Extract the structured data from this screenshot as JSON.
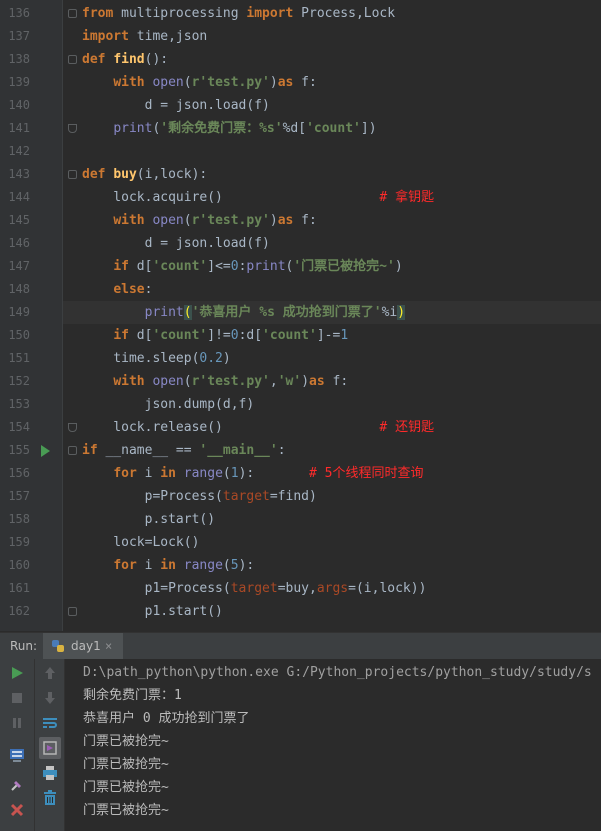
{
  "editor": {
    "line_numbers": [
      "136",
      "137",
      "138",
      "139",
      "140",
      "141",
      "142",
      "143",
      "144",
      "145",
      "146",
      "147",
      "148",
      "149",
      "150",
      "151",
      "152",
      "153",
      "154",
      "155",
      "156",
      "157",
      "158",
      "159",
      "160",
      "161",
      "162"
    ],
    "lines": [
      {
        "tokens": [
          [
            "kw",
            "from"
          ],
          [
            "t",
            " multiprocessing "
          ],
          [
            "kw",
            "import"
          ],
          [
            "t",
            " Process,Lock"
          ]
        ]
      },
      {
        "tokens": [
          [
            "kw",
            "import"
          ],
          [
            "t",
            " time,json"
          ]
        ]
      },
      {
        "tokens": [
          [
            "kw",
            "def"
          ],
          [
            "t",
            " "
          ],
          [
            "fn",
            "find"
          ],
          [
            "t",
            "():"
          ]
        ]
      },
      {
        "tokens": [
          [
            "t",
            "    "
          ],
          [
            "kw",
            "with"
          ],
          [
            "t",
            " "
          ],
          [
            "bi",
            "open"
          ],
          [
            "t",
            "("
          ],
          [
            "str",
            "r'test.py'"
          ],
          [
            "t",
            ")"
          ],
          [
            "kw",
            "as"
          ],
          [
            "t",
            " f:"
          ]
        ]
      },
      {
        "tokens": [
          [
            "t",
            "        d = json.load(f)"
          ]
        ]
      },
      {
        "tokens": [
          [
            "t",
            "    "
          ],
          [
            "bi",
            "print"
          ],
          [
            "t",
            "("
          ],
          [
            "str",
            "'剩余免费门票：%s'"
          ],
          [
            "t",
            "%d["
          ],
          [
            "str",
            "'count'"
          ],
          [
            "t",
            "])"
          ]
        ]
      },
      {
        "tokens": []
      },
      {
        "tokens": [
          [
            "kw",
            "def"
          ],
          [
            "t",
            " "
          ],
          [
            "fn",
            "buy"
          ],
          [
            "t",
            "(i,lock):"
          ]
        ]
      },
      {
        "tokens": [
          [
            "t",
            "    lock.acquire()                    "
          ],
          [
            "cmt",
            "# 拿钥匙"
          ]
        ]
      },
      {
        "tokens": [
          [
            "t",
            "    "
          ],
          [
            "kw",
            "with"
          ],
          [
            "t",
            " "
          ],
          [
            "bi",
            "open"
          ],
          [
            "t",
            "("
          ],
          [
            "str",
            "r'test.py'"
          ],
          [
            "t",
            ")"
          ],
          [
            "kw",
            "as"
          ],
          [
            "t",
            " f:"
          ]
        ]
      },
      {
        "tokens": [
          [
            "t",
            "        d = json.load(f)"
          ]
        ]
      },
      {
        "tokens": [
          [
            "t",
            "    "
          ],
          [
            "kw",
            "if"
          ],
          [
            "t",
            " d["
          ],
          [
            "str",
            "'count'"
          ],
          [
            "t",
            "]<="
          ],
          [
            "num",
            "0"
          ],
          [
            "t",
            ":"
          ],
          [
            "bi",
            "print"
          ],
          [
            "t",
            "("
          ],
          [
            "str",
            "'门票已被抢完~'"
          ],
          [
            "t",
            ")"
          ]
        ]
      },
      {
        "tokens": [
          [
            "t",
            "    "
          ],
          [
            "kw",
            "else"
          ],
          [
            "t",
            ":"
          ]
        ]
      },
      {
        "tokens": [
          [
            "t",
            "        "
          ],
          [
            "bi",
            "print"
          ],
          [
            "hl",
            "("
          ],
          [
            "str",
            "'恭喜用户 %s 成功抢到门票了'"
          ],
          [
            "t",
            "%i"
          ],
          [
            "hl",
            ")"
          ]
        ]
      },
      {
        "tokens": [
          [
            "t",
            "    "
          ],
          [
            "kw",
            "if"
          ],
          [
            "t",
            " d["
          ],
          [
            "str",
            "'count'"
          ],
          [
            "t",
            "]!="
          ],
          [
            "num",
            "0"
          ],
          [
            "t",
            ":d["
          ],
          [
            "str",
            "'count'"
          ],
          [
            "t",
            "]-="
          ],
          [
            "num",
            "1"
          ]
        ]
      },
      {
        "tokens": [
          [
            "t",
            "    time.sleep("
          ],
          [
            "num",
            "0.2"
          ],
          [
            "t",
            ")"
          ]
        ]
      },
      {
        "tokens": [
          [
            "t",
            "    "
          ],
          [
            "kw",
            "with"
          ],
          [
            "t",
            " "
          ],
          [
            "bi",
            "open"
          ],
          [
            "t",
            "("
          ],
          [
            "str",
            "r'test.py'"
          ],
          [
            "t",
            ","
          ],
          [
            "str",
            "'w'"
          ],
          [
            "t",
            ")"
          ],
          [
            "kw",
            "as"
          ],
          [
            "t",
            " f:"
          ]
        ]
      },
      {
        "tokens": [
          [
            "t",
            "        json.dump(d,f)"
          ]
        ]
      },
      {
        "tokens": [
          [
            "t",
            "    lock.release()                    "
          ],
          [
            "cmt",
            "# 还钥匙"
          ]
        ]
      },
      {
        "tokens": [
          [
            "kw",
            "if"
          ],
          [
            "t",
            " __name__ == "
          ],
          [
            "str",
            "'__main__'"
          ],
          [
            "t",
            ":"
          ]
        ]
      },
      {
        "tokens": [
          [
            "t",
            "    "
          ],
          [
            "kw",
            "for"
          ],
          [
            "t",
            " i "
          ],
          [
            "kw",
            "in"
          ],
          [
            "t",
            " "
          ],
          [
            "bi",
            "range"
          ],
          [
            "t",
            "("
          ],
          [
            "num",
            "1"
          ],
          [
            "t",
            "):       "
          ],
          [
            "cmt",
            "# 5个线程同时查询"
          ]
        ]
      },
      {
        "tokens": [
          [
            "t",
            "        p=Process("
          ],
          [
            "param",
            "target"
          ],
          [
            "t",
            "=find)"
          ]
        ]
      },
      {
        "tokens": [
          [
            "t",
            "        p.start()"
          ]
        ]
      },
      {
        "tokens": [
          [
            "t",
            "    lock=Lock()"
          ]
        ]
      },
      {
        "tokens": [
          [
            "t",
            "    "
          ],
          [
            "kw",
            "for"
          ],
          [
            "t",
            " i "
          ],
          [
            "kw",
            "in"
          ],
          [
            "t",
            " "
          ],
          [
            "bi",
            "range"
          ],
          [
            "t",
            "("
          ],
          [
            "num",
            "5"
          ],
          [
            "t",
            "):"
          ]
        ]
      },
      {
        "tokens": [
          [
            "t",
            "        p1=Process("
          ],
          [
            "param",
            "target"
          ],
          [
            "t",
            "=buy,"
          ],
          [
            "param",
            "args"
          ],
          [
            "t",
            "=(i,lock))"
          ]
        ]
      },
      {
        "tokens": [
          [
            "t",
            "        p1.start()"
          ]
        ]
      }
    ]
  },
  "run_panel": {
    "label": "Run:",
    "tab_label": "day1",
    "tab_close": "×",
    "output": [
      "D:\\path_python\\python.exe G:/Python_projects/python_study/study/s",
      "剩余免费门票：1",
      "恭喜用户 0 成功抢到门票了",
      "门票已被抢完~",
      "门票已被抢完~",
      "门票已被抢完~",
      "门票已被抢完~"
    ]
  },
  "colors": {
    "keyword": "#cc7832",
    "string": "#6a8759",
    "comment": "#ff2b2b",
    "number": "#6897bb",
    "run_green": "#499c54"
  },
  "icons": {
    "run": "play-icon",
    "stop": "stop-icon",
    "pause": "pause-icon",
    "up": "arrow-up-icon",
    "down": "arrow-down-icon",
    "wrap": "soft-wrap-icon",
    "scroll": "scroll-to-end-icon",
    "print": "print-icon",
    "trash": "trash-icon",
    "dump": "dump-threads-icon",
    "pin": "pin-icon",
    "close": "close-icon"
  }
}
